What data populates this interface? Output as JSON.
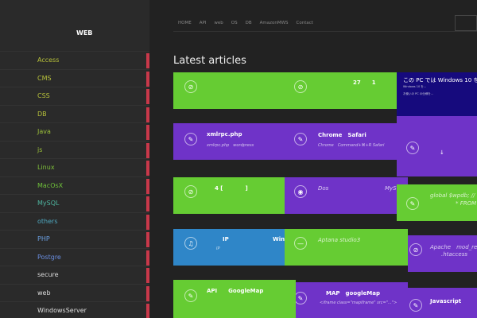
{
  "site": {
    "title": "WEB"
  },
  "sidebar": {
    "items": [
      {
        "label": "Access",
        "color": "#b7c13a"
      },
      {
        "label": "CMS",
        "color": "#b7c13a"
      },
      {
        "label": "CSS",
        "color": "#b7c13a"
      },
      {
        "label": "DB",
        "color": "#b7c13a"
      },
      {
        "label": "Java",
        "color": "#9cc13a"
      },
      {
        "label": "js",
        "color": "#9cc13a"
      },
      {
        "label": "Linux",
        "color": "#7fc13a"
      },
      {
        "label": "MacOsX",
        "color": "#6fc13a"
      },
      {
        "label": "MySQL",
        "color": "#4fb6a0"
      },
      {
        "label": "others",
        "color": "#4fa8c0"
      },
      {
        "label": "PHP",
        "color": "#6a9ee0"
      },
      {
        "label": "Postgre",
        "color": "#6a8ee0"
      },
      {
        "label": "secure",
        "color": "#dddddd"
      },
      {
        "label": "web",
        "color": "#dddddd"
      },
      {
        "label": "WindowsServer",
        "color": "#dddddd"
      }
    ]
  },
  "nav": {
    "items": [
      "HOME",
      "API",
      "web",
      "OS",
      "DB",
      "AmazonMWS",
      "Contact"
    ]
  },
  "main": {
    "heading": "Latest articles"
  },
  "tiles": {
    "t1": {
      "icon": "link-icon",
      "title": ""
    },
    "t2": {
      "icon": "link-icon",
      "title": "27　　1"
    },
    "win": {
      "title": "この PC では Windows 10 を",
      "sub": "Windows 10 を...",
      "line": "お使いの PC の仕様を..."
    },
    "t3": {
      "icon": "pencil-icon",
      "title": "xmlrpc.php",
      "sub": "xmlrpc.php　wordpress"
    },
    "t4": {
      "icon": "pencil-icon",
      "title": "Chrome　Safari",
      "sub": "Chrome　Command+⌘+R Safari"
    },
    "t5": {
      "icon": "pencil-icon",
      "title": "↓"
    },
    "t6": {
      "icon": "link-icon",
      "title": "4 [　　　　]"
    },
    "t7": {
      "icon": "eye-icon",
      "text": "Dos",
      "text2": "MySQ"
    },
    "t8": {
      "icon": "pencil-icon",
      "text": "global $wpdb; //",
      "text2": "* FROM {"
    },
    "t9": {
      "icon": "music-icon",
      "title": "IP",
      "sub": "IP",
      "title2": "Win"
    },
    "t10": {
      "icon": "minus-icon",
      "text": "Aptana studio3"
    },
    "t11": {
      "icon": "link-icon",
      "text": "Apache　mod_rew",
      "text2": ".htaccess"
    },
    "t12": {
      "icon": "pencil-icon",
      "title": "API　　GoogleMap"
    },
    "t13": {
      "icon": "pencil-icon",
      "title": "MAP　googleMap",
      "sub": "<iframe class=\"mapiframe\" src=\"...\">"
    },
    "t14": {
      "icon": "pencil-icon",
      "title": "Javascript"
    }
  }
}
